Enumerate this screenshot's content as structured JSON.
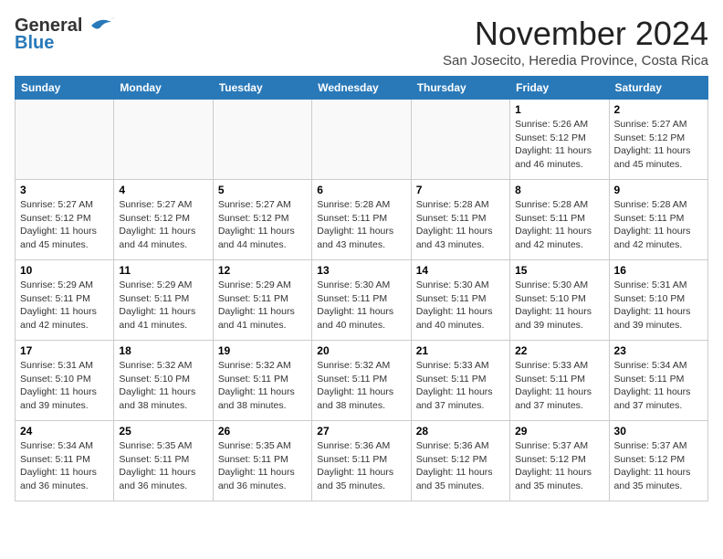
{
  "logo": {
    "line1": "General",
    "line2": "Blue"
  },
  "title": "November 2024",
  "location": "San Josecito, Heredia Province, Costa Rica",
  "weekdays": [
    "Sunday",
    "Monday",
    "Tuesday",
    "Wednesday",
    "Thursday",
    "Friday",
    "Saturday"
  ],
  "weeks": [
    [
      {
        "day": "",
        "info": ""
      },
      {
        "day": "",
        "info": ""
      },
      {
        "day": "",
        "info": ""
      },
      {
        "day": "",
        "info": ""
      },
      {
        "day": "",
        "info": ""
      },
      {
        "day": "1",
        "info": "Sunrise: 5:26 AM\nSunset: 5:12 PM\nDaylight: 11 hours and 46 minutes."
      },
      {
        "day": "2",
        "info": "Sunrise: 5:27 AM\nSunset: 5:12 PM\nDaylight: 11 hours and 45 minutes."
      }
    ],
    [
      {
        "day": "3",
        "info": "Sunrise: 5:27 AM\nSunset: 5:12 PM\nDaylight: 11 hours and 45 minutes."
      },
      {
        "day": "4",
        "info": "Sunrise: 5:27 AM\nSunset: 5:12 PM\nDaylight: 11 hours and 44 minutes."
      },
      {
        "day": "5",
        "info": "Sunrise: 5:27 AM\nSunset: 5:12 PM\nDaylight: 11 hours and 44 minutes."
      },
      {
        "day": "6",
        "info": "Sunrise: 5:28 AM\nSunset: 5:11 PM\nDaylight: 11 hours and 43 minutes."
      },
      {
        "day": "7",
        "info": "Sunrise: 5:28 AM\nSunset: 5:11 PM\nDaylight: 11 hours and 43 minutes."
      },
      {
        "day": "8",
        "info": "Sunrise: 5:28 AM\nSunset: 5:11 PM\nDaylight: 11 hours and 42 minutes."
      },
      {
        "day": "9",
        "info": "Sunrise: 5:28 AM\nSunset: 5:11 PM\nDaylight: 11 hours and 42 minutes."
      }
    ],
    [
      {
        "day": "10",
        "info": "Sunrise: 5:29 AM\nSunset: 5:11 PM\nDaylight: 11 hours and 42 minutes."
      },
      {
        "day": "11",
        "info": "Sunrise: 5:29 AM\nSunset: 5:11 PM\nDaylight: 11 hours and 41 minutes."
      },
      {
        "day": "12",
        "info": "Sunrise: 5:29 AM\nSunset: 5:11 PM\nDaylight: 11 hours and 41 minutes."
      },
      {
        "day": "13",
        "info": "Sunrise: 5:30 AM\nSunset: 5:11 PM\nDaylight: 11 hours and 40 minutes."
      },
      {
        "day": "14",
        "info": "Sunrise: 5:30 AM\nSunset: 5:11 PM\nDaylight: 11 hours and 40 minutes."
      },
      {
        "day": "15",
        "info": "Sunrise: 5:30 AM\nSunset: 5:10 PM\nDaylight: 11 hours and 39 minutes."
      },
      {
        "day": "16",
        "info": "Sunrise: 5:31 AM\nSunset: 5:10 PM\nDaylight: 11 hours and 39 minutes."
      }
    ],
    [
      {
        "day": "17",
        "info": "Sunrise: 5:31 AM\nSunset: 5:10 PM\nDaylight: 11 hours and 39 minutes."
      },
      {
        "day": "18",
        "info": "Sunrise: 5:32 AM\nSunset: 5:10 PM\nDaylight: 11 hours and 38 minutes."
      },
      {
        "day": "19",
        "info": "Sunrise: 5:32 AM\nSunset: 5:11 PM\nDaylight: 11 hours and 38 minutes."
      },
      {
        "day": "20",
        "info": "Sunrise: 5:32 AM\nSunset: 5:11 PM\nDaylight: 11 hours and 38 minutes."
      },
      {
        "day": "21",
        "info": "Sunrise: 5:33 AM\nSunset: 5:11 PM\nDaylight: 11 hours and 37 minutes."
      },
      {
        "day": "22",
        "info": "Sunrise: 5:33 AM\nSunset: 5:11 PM\nDaylight: 11 hours and 37 minutes."
      },
      {
        "day": "23",
        "info": "Sunrise: 5:34 AM\nSunset: 5:11 PM\nDaylight: 11 hours and 37 minutes."
      }
    ],
    [
      {
        "day": "24",
        "info": "Sunrise: 5:34 AM\nSunset: 5:11 PM\nDaylight: 11 hours and 36 minutes."
      },
      {
        "day": "25",
        "info": "Sunrise: 5:35 AM\nSunset: 5:11 PM\nDaylight: 11 hours and 36 minutes."
      },
      {
        "day": "26",
        "info": "Sunrise: 5:35 AM\nSunset: 5:11 PM\nDaylight: 11 hours and 36 minutes."
      },
      {
        "day": "27",
        "info": "Sunrise: 5:36 AM\nSunset: 5:11 PM\nDaylight: 11 hours and 35 minutes."
      },
      {
        "day": "28",
        "info": "Sunrise: 5:36 AM\nSunset: 5:12 PM\nDaylight: 11 hours and 35 minutes."
      },
      {
        "day": "29",
        "info": "Sunrise: 5:37 AM\nSunset: 5:12 PM\nDaylight: 11 hours and 35 minutes."
      },
      {
        "day": "30",
        "info": "Sunrise: 5:37 AM\nSunset: 5:12 PM\nDaylight: 11 hours and 35 minutes."
      }
    ]
  ]
}
